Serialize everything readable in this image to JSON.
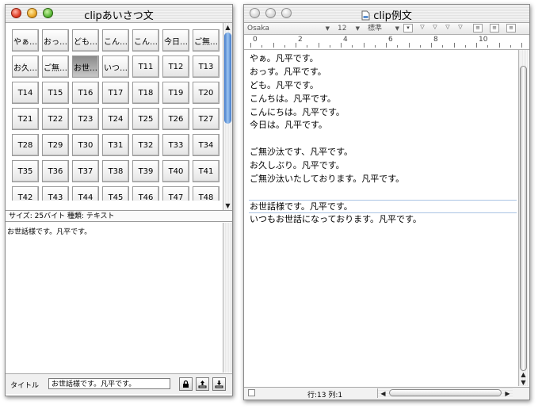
{
  "left_window": {
    "title": "clipあいさつ文",
    "cells": [
      "やぁ…",
      "おっ…",
      "ども…",
      "こん…",
      "こん…",
      "今日…",
      "ご無…",
      "お久…",
      "ご無…",
      "お世…",
      "いつ…",
      "T11",
      "T12",
      "T13",
      "T14",
      "T15",
      "T16",
      "T17",
      "T18",
      "T19",
      "T20",
      "T21",
      "T22",
      "T23",
      "T24",
      "T25",
      "T26",
      "T27",
      "T28",
      "T29",
      "T30",
      "T31",
      "T32",
      "T33",
      "T34",
      "T35",
      "T36",
      "T37",
      "T38",
      "T39",
      "T40",
      "T41",
      "T42",
      "T43",
      "T44",
      "T45",
      "T46",
      "T47",
      "T48"
    ],
    "selected_index": 9,
    "info": "サイズ: 25バイト  種類: テキスト",
    "preview_text": "お世話様です。凡平です。",
    "title_label": "タイトル",
    "title_value": "お世話様です。凡平です。"
  },
  "right_window": {
    "title": "clip例文",
    "font": "Osaka",
    "size": "12",
    "style": "標準",
    "ruler_numbers": [
      "0",
      "2",
      "4",
      "6",
      "8",
      "10"
    ],
    "lines": [
      "やぁ。凡平です。",
      "おっす。凡平です。",
      "ども。凡平です。",
      "こんちは。凡平です。",
      "こんにちは。凡平です。",
      "今日は。凡平です。",
      "",
      "ご無沙汰です、凡平です。",
      "お久しぶり。凡平です。",
      "ご無沙汰いたしております。凡平です。",
      "",
      "お世話様です。凡平です。",
      "いつもお世話になっております。凡平です。"
    ],
    "highlight_index": 11,
    "status": "行:13 列:1"
  }
}
